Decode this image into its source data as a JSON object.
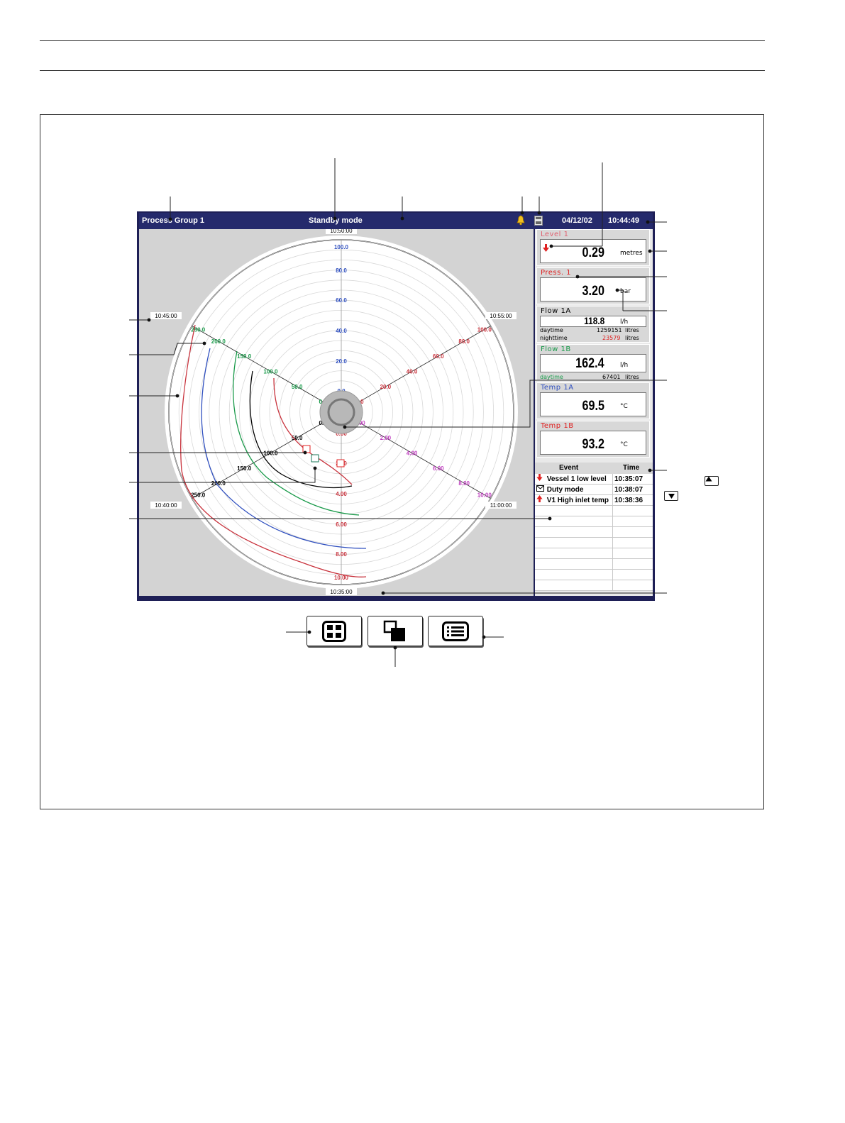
{
  "screen": {
    "title": "Process Group 1",
    "mode": "Standby mode",
    "date": "04/12/02",
    "time": "10:44:49",
    "alarm_icon": "alarm-bell-icon",
    "media_icon": "archive-media-icon"
  },
  "chart_data": {
    "type": "circular-chart",
    "time_labels": [
      "10:50:00",
      "10:45:00",
      "10:55:00",
      "10:40:00",
      "11:00:00",
      "10:35:00"
    ],
    "scales": [
      {
        "color": "#2f4fbf",
        "values": [
          "0.0",
          "20.0",
          "40.0",
          "60.0",
          "80.0",
          "100.0"
        ]
      },
      {
        "color": "#c8323c",
        "values": [
          "0.0",
          "20.0",
          "40.0",
          "60.0",
          "80.0",
          "100.0"
        ]
      },
      {
        "color": "#c040c0",
        "values": [
          "0.00",
          "2.00",
          "4.00",
          "6.00",
          "8.00",
          "10.00"
        ]
      },
      {
        "color": "#c8323c",
        "values": [
          "0.00",
          "2.00",
          "4.00",
          "6.00",
          "8.00",
          "10.00"
        ]
      },
      {
        "color": "#000000",
        "values": [
          "0.0",
          "50.0",
          "100.0",
          "150.0",
          "200.0",
          "250.0"
        ]
      },
      {
        "color": "#1a9a4a",
        "values": [
          "0.0",
          "50.0",
          "100.0",
          "150.0",
          "200.0",
          "250.0"
        ]
      }
    ],
    "series_colors": [
      "#c8323c",
      "#2f4fbf",
      "#1a9a4a",
      "#000000",
      "#c8323c",
      "#c040c0"
    ]
  },
  "indicators": [
    {
      "tag": "Level 1",
      "tag_color": "#e06070",
      "value": "0.29",
      "unit": "metres",
      "alarm": "down"
    },
    {
      "tag": "Press. 1",
      "tag_color": "#e02020",
      "value": "3.20",
      "unit": "bar"
    },
    {
      "tag": "Flow 1A",
      "tag_color": "#000000",
      "value": "118.8",
      "unit": "l/h",
      "totals": [
        {
          "label": "daytime",
          "value": "1259151",
          "unit": "litres",
          "color": "#000000"
        },
        {
          "label": "nighttime",
          "value": "23579",
          "unit": "litres",
          "color": "#e02020"
        }
      ]
    },
    {
      "tag": "Flow 1B",
      "tag_color": "#1a9a4a",
      "value": "162.4",
      "unit": "l/h",
      "totals": [
        {
          "label": "daytime",
          "value": "67401",
          "unit": "litres",
          "color": "#1a9a4a"
        }
      ]
    },
    {
      "tag": "Temp 1A",
      "tag_color": "#2f4fbf",
      "value": "69.5",
      "unit": "°C"
    },
    {
      "tag": "Temp 1B",
      "tag_color": "#e02020",
      "value": "93.2",
      "unit": "°C"
    }
  ],
  "events": {
    "header_event": "Event",
    "header_time": "Time",
    "rows": [
      {
        "icon": "down-arrow-icon",
        "text": "Vessel 1 low level",
        "time": "10:35:07"
      },
      {
        "icon": "envelope-icon",
        "text": "Duty mode",
        "time": "10:38:07"
      },
      {
        "icon": "up-arrow-icon",
        "text": "V1 High inlet temp",
        "time": "10:38:36"
      }
    ],
    "empty_rows": 8
  },
  "softkeys": [
    {
      "name": "grid-view-icon"
    },
    {
      "name": "overlay-view-icon"
    },
    {
      "name": "list-view-icon"
    }
  ]
}
